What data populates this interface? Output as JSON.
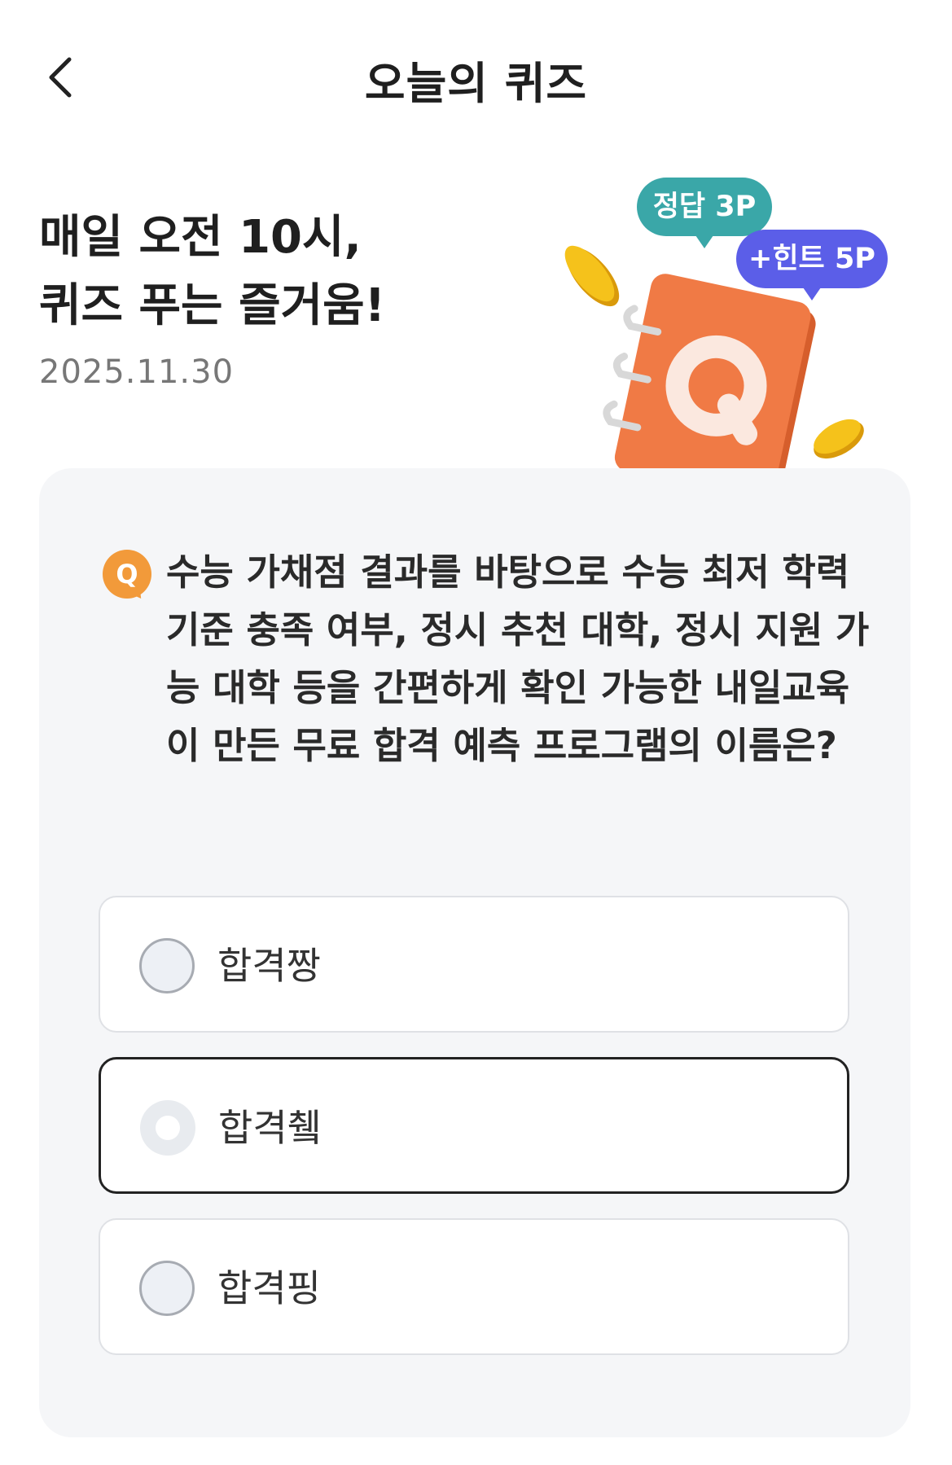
{
  "header": {
    "title": "오늘의 퀴즈",
    "back_icon": "chevron-left-icon"
  },
  "hero": {
    "line1": "매일 오전 10시,",
    "line2": "퀴즈 푸는 즐거움!",
    "date": "2025.11.30"
  },
  "illustration": {
    "badge_answer": "정답 3P",
    "badge_hint": "+힌트 5P",
    "book_letter": "Q",
    "colors": {
      "book": "#f07a45",
      "answer_badge": "#3aa7a8",
      "hint_badge": "#5b5ee8",
      "coin": "#f5c21b"
    }
  },
  "quiz": {
    "q_badge": "Q",
    "question": "수능 가채점 결과를 바탕으로 수능 최저 학력 기준 충족 여부, 정시 추천 대학, 정시 지원 가능 대학 등을 간편하게 확인 가능한 내일교육이 만든 무료 합격 예측 프로그램의 이름은?",
    "options": [
      {
        "label": "합격짱",
        "selected": false
      },
      {
        "label": "합격췤",
        "selected": true
      },
      {
        "label": "합격핑",
        "selected": false
      }
    ]
  }
}
